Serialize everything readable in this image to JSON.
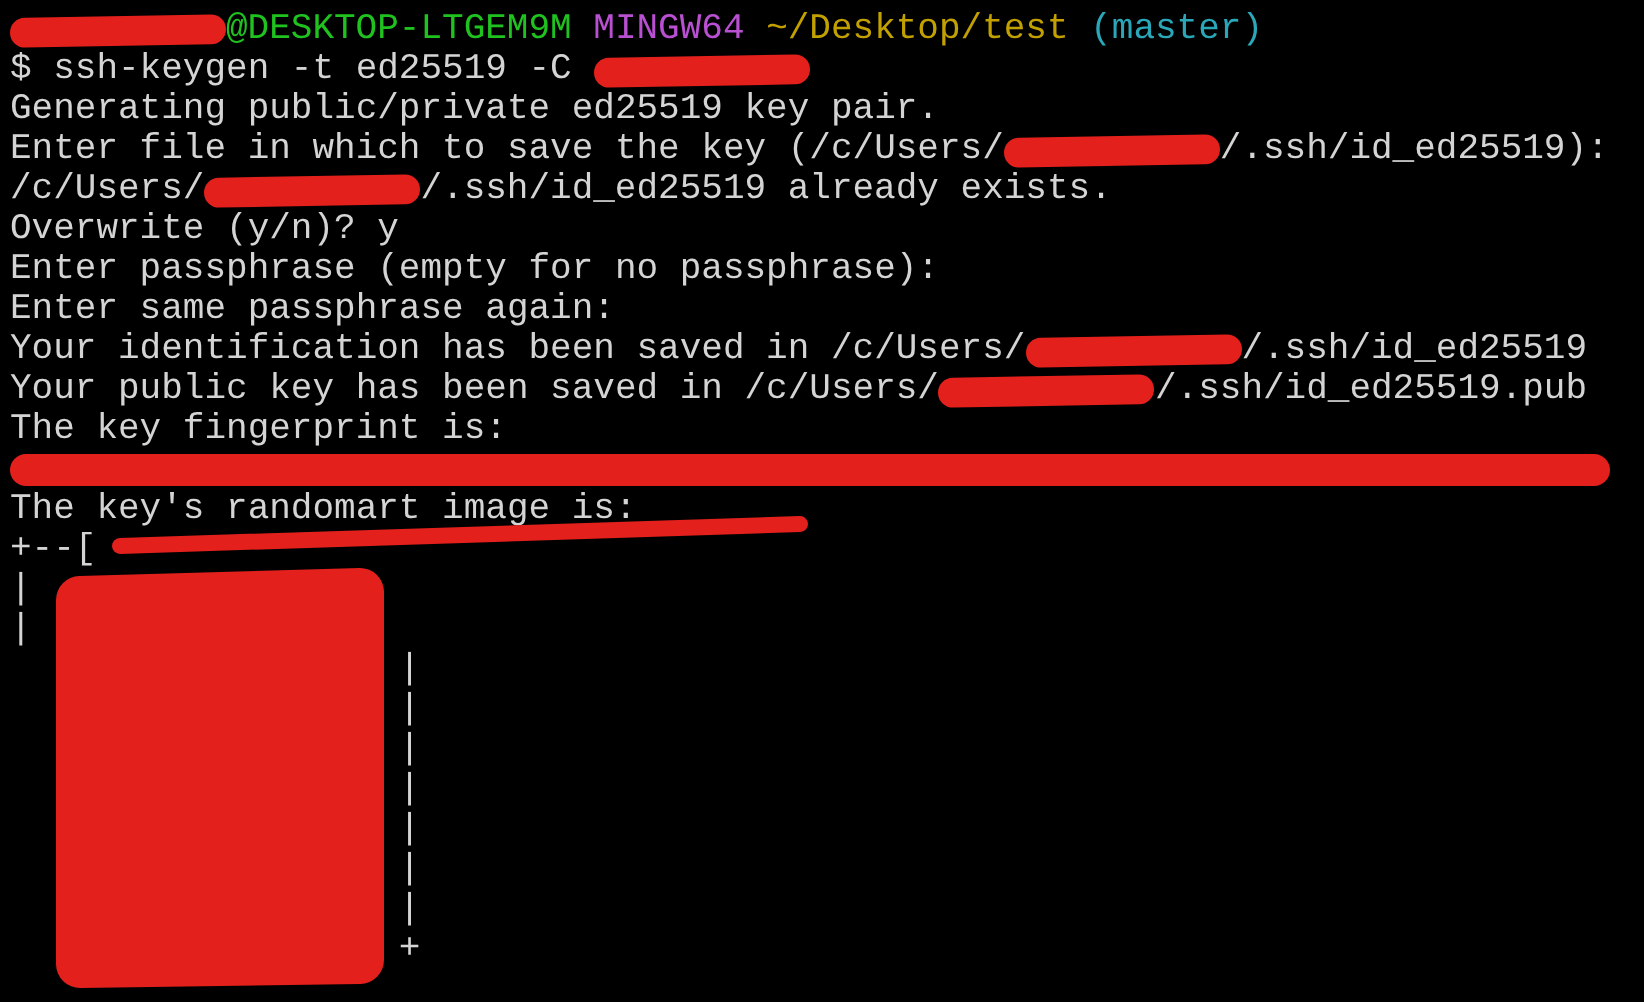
{
  "terminal": {
    "lines": [
      [
        {
          "kind": "redacted"
        },
        {
          "kind": "text",
          "text": "@DESKTOP-LTGEM9M ",
          "color": "#1fc21f"
        },
        {
          "kind": "text",
          "text": "MINGW64 ",
          "color": "#b94fd1"
        },
        {
          "kind": "text",
          "text": "~/Desktop/test ",
          "color": "#c2a000"
        },
        {
          "kind": "text",
          "text": "(master)",
          "color": "#2aa7b8"
        }
      ],
      [
        {
          "kind": "text",
          "text": "$ ssh-keygen -t ed25519 -C "
        },
        {
          "kind": "redacted"
        }
      ],
      [
        {
          "kind": "text",
          "text": "Generating public/private ed25519 key pair."
        }
      ],
      [
        {
          "kind": "text",
          "text": "Enter file in which to save the key (/c/Users/"
        },
        {
          "kind": "redacted"
        },
        {
          "kind": "text",
          "text": "/.ssh/id_ed25519):"
        }
      ],
      [
        {
          "kind": "text",
          "text": "/c/Users/"
        },
        {
          "kind": "redacted"
        },
        {
          "kind": "text",
          "text": "/.ssh/id_ed25519 already exists."
        }
      ],
      [
        {
          "kind": "text",
          "text": "Overwrite (y/n)? y"
        }
      ],
      [
        {
          "kind": "text",
          "text": "Enter passphrase (empty for no passphrase):"
        }
      ],
      [
        {
          "kind": "text",
          "text": "Enter same passphrase again:"
        }
      ],
      [
        {
          "kind": "text",
          "text": "Your identification has been saved in /c/Users/"
        },
        {
          "kind": "redacted"
        },
        {
          "kind": "text",
          "text": "/.ssh/id_ed25519"
        }
      ],
      [
        {
          "kind": "text",
          "text": "Your public key has been saved in /c/Users/"
        },
        {
          "kind": "redacted"
        },
        {
          "kind": "text",
          "text": "/.ssh/id_ed25519.pub"
        }
      ],
      [
        {
          "kind": "text",
          "text": "The key fingerprint is:"
        }
      ],
      [
        {
          "kind": "scrawl"
        }
      ],
      [
        {
          "kind": "text",
          "text": "The key's randomart image is:"
        }
      ],
      [
        {
          "kind": "text",
          "text": "+--["
        }
      ],
      [
        {
          "kind": "text",
          "text": "|"
        }
      ],
      [
        {
          "kind": "text",
          "text": "|"
        }
      ],
      [
        {
          "kind": "text",
          "text": "                  |"
        }
      ],
      [
        {
          "kind": "text",
          "text": "                  |"
        }
      ],
      [
        {
          "kind": "text",
          "text": "                  |"
        }
      ],
      [
        {
          "kind": "text",
          "text": "                  |"
        }
      ],
      [
        {
          "kind": "text",
          "text": "                  |"
        }
      ],
      [
        {
          "kind": "text",
          "text": "                  |"
        }
      ],
      [
        {
          "kind": "text",
          "text": "                  |"
        }
      ],
      [
        {
          "kind": "text",
          "text": "                  +"
        }
      ]
    ]
  }
}
